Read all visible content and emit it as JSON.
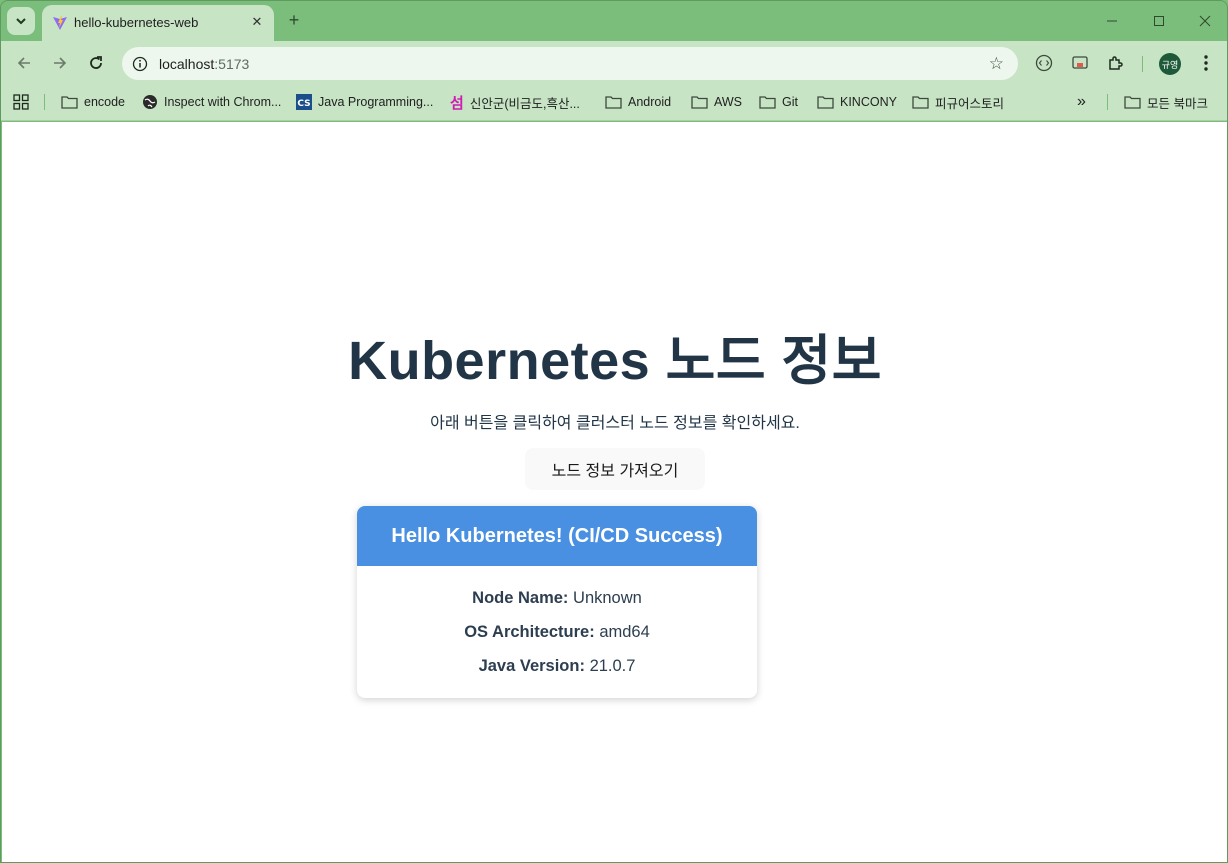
{
  "browser": {
    "tab_title": "hello-kubernetes-web",
    "url_host": "localhost",
    "url_port": ":5173",
    "avatar_text": "규영",
    "bookmarks": [
      {
        "label": "encode",
        "icon": "folder-icon"
      },
      {
        "label": "Inspect with Chrom...",
        "icon": "globe-icon"
      },
      {
        "label": "Java Programming...",
        "icon": "cs-icon"
      },
      {
        "label": "신안군(비금도,흑산...",
        "icon": "sum-icon"
      },
      {
        "label": "Android",
        "icon": "folder-icon"
      },
      {
        "label": "AWS",
        "icon": "folder-icon"
      },
      {
        "label": "Git",
        "icon": "folder-icon"
      },
      {
        "label": "KINCONY",
        "icon": "folder-icon"
      },
      {
        "label": "피규어스토리",
        "icon": "folder-icon"
      }
    ],
    "all_bookmarks_label": "모든 북마크",
    "overflow_label": "»"
  },
  "page": {
    "title": "Kubernetes 노드 정보",
    "description": "아래 버튼을 클릭하여 클러스터 노드 정보를 확인하세요.",
    "fetch_button": "노드 정보 가져오기",
    "card": {
      "header": "Hello Kubernetes! (CI/CD Success)",
      "rows": [
        {
          "label": "Node Name:",
          "value": "Unknown"
        },
        {
          "label": "OS Architecture:",
          "value": "amd64"
        },
        {
          "label": "Java Version:",
          "value": "21.0.7"
        }
      ]
    }
  },
  "colors": {
    "browser_frame": "#7bbd7b",
    "toolbar": "#c7e4c5",
    "card_header": "#4a90e2",
    "title_text": "#213547"
  }
}
